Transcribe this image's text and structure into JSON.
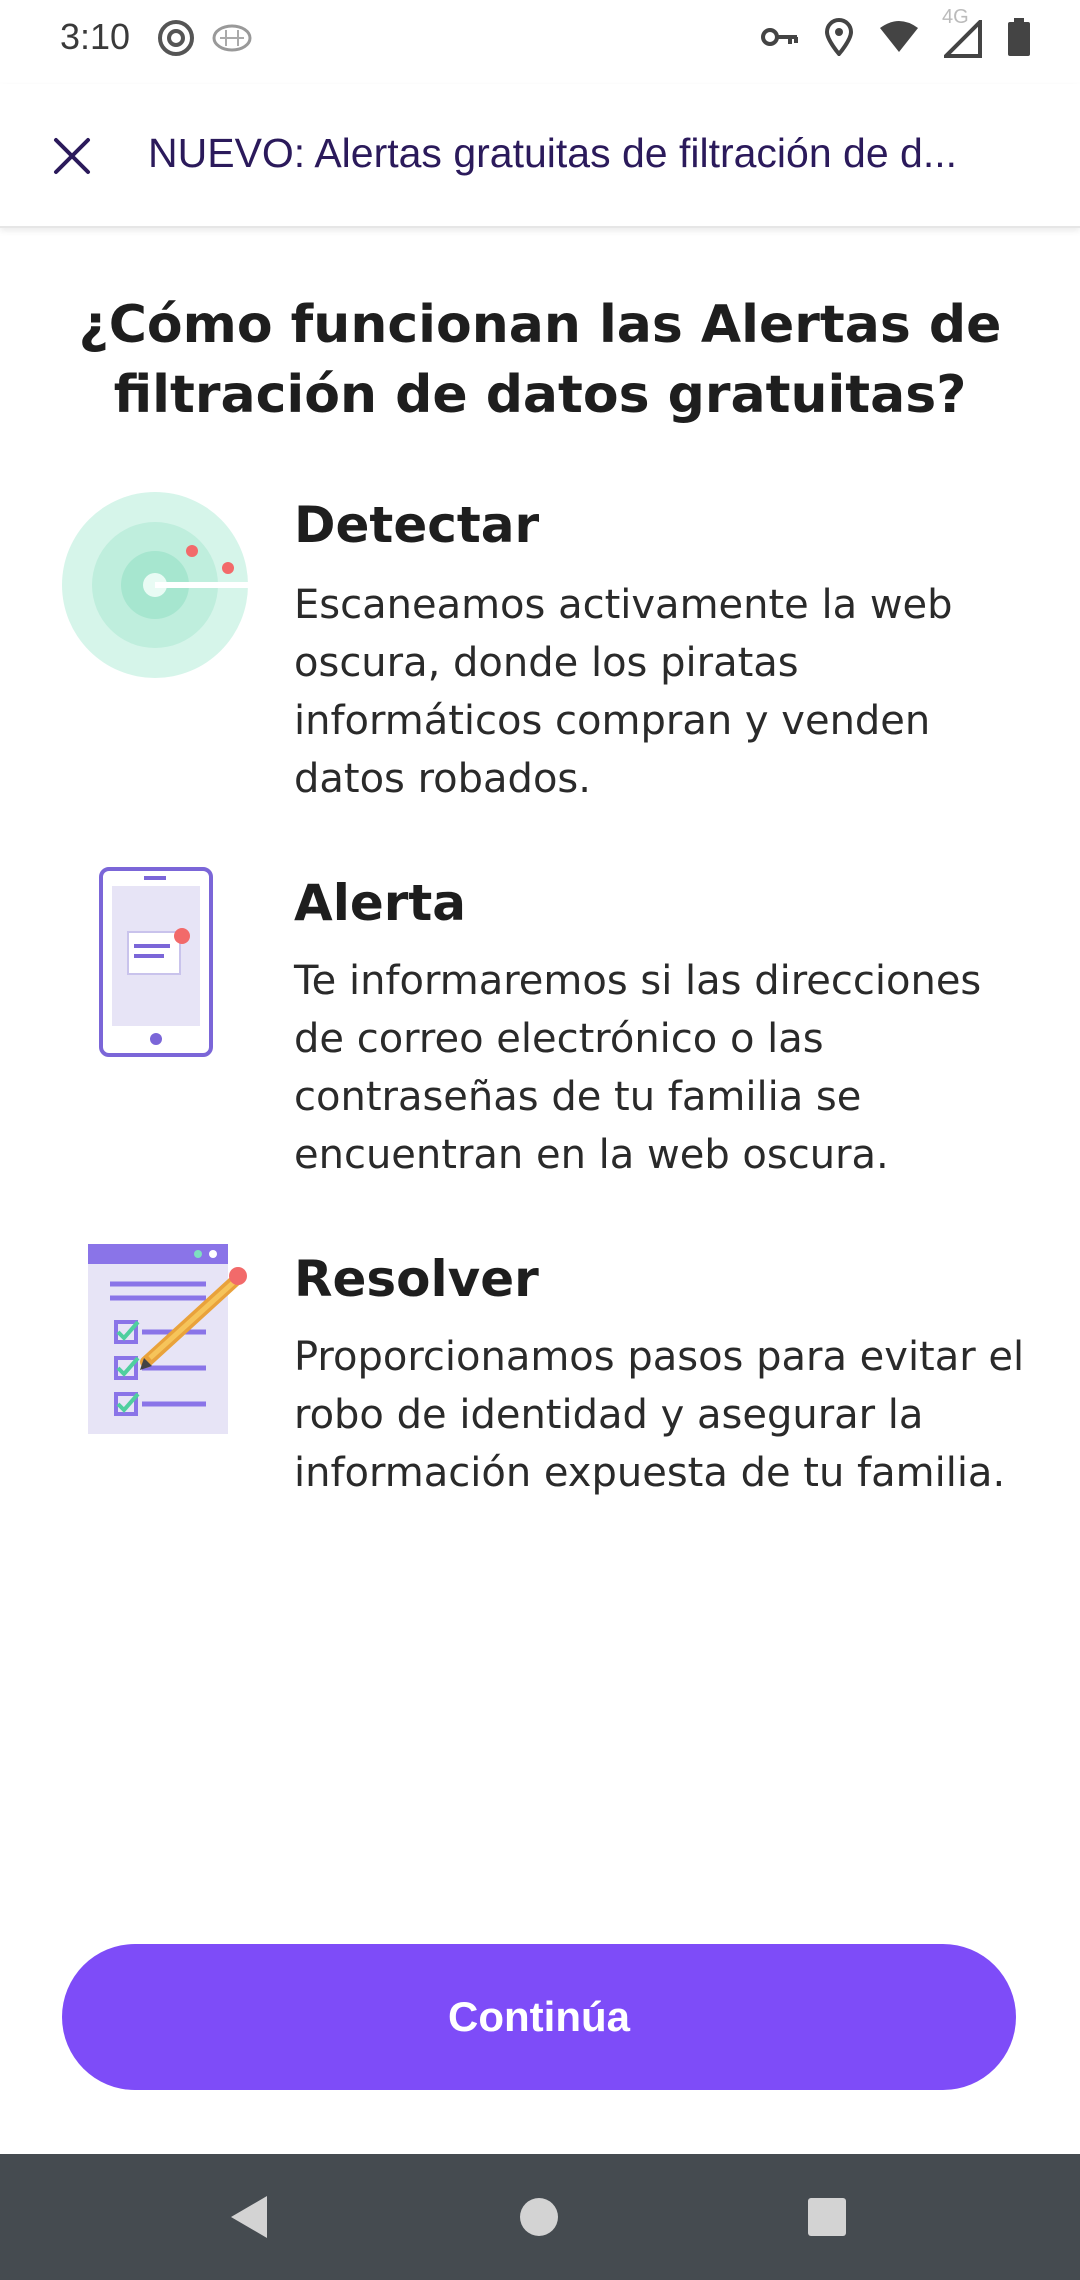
{
  "status_bar": {
    "time": "3:10",
    "network": "4G"
  },
  "app_bar": {
    "title": "NUEVO: Alertas gratuitas de filtración de d..."
  },
  "heading": "¿Cómo funcionan las Alertas de filtración de datos gratuitas?",
  "features": [
    {
      "icon": "radar-icon",
      "title": "Detectar",
      "description": "Escaneamos activamente la web oscura, donde los piratas informáticos compran y venden datos robados."
    },
    {
      "icon": "phone-alert-icon",
      "title": "Alerta",
      "description": "Te informaremos si las direcciones de correo electrónico o las contraseñas de tu familia se encuentran en la web oscura."
    },
    {
      "icon": "checklist-icon",
      "title": "Resolver",
      "description": "Proporcionamos pasos para evitar el robo de identidad y asegurar la información expuesta de tu familia."
    }
  ],
  "cta": {
    "label": "Continúa"
  },
  "colors": {
    "accent": "#7e4cf8",
    "title_text": "#2b1a5b",
    "nav_bar": "#454b50"
  }
}
